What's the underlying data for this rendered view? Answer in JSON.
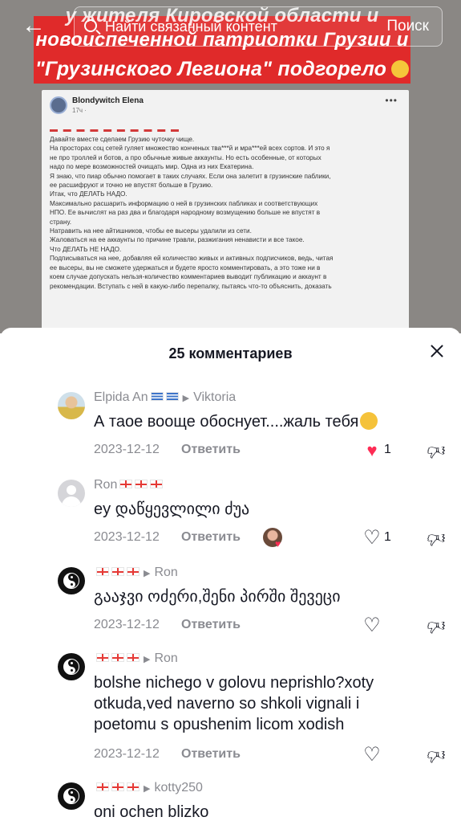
{
  "topbar": {
    "back_icon": "arrow-left-icon",
    "search_placeholder": "Найти связанный контент",
    "search_button": "Поиск"
  },
  "video": {
    "banner_line1": "у жителя Кировской области и",
    "banner_line2": "новоиспеченной патриотки Грузии и",
    "banner_line3": "\"Грузинского Легиона\" подгорело",
    "post": {
      "author": "Blondywitch Elena",
      "meta": "17ч · ",
      "lines": [
        "Давайте вместе сделаем Грузию чуточку чище.",
        "На просторах соц сетей гуляет множество конченых тва***й и мра***ей всех сортов. И это я",
        "не про троллей и ботов, а про обычные живые аккаунты. Но есть особенные, от которых",
        "надо по мере возможностей очищать мир. Одна из них Екатерина.",
        "Я знаю, что пиар обычно помогает в таких случаях. Если она залетит в грузинские паблики,",
        "ее расшифруют и точно не впустят больше в Грузию.",
        "Итак, что ДЕЛАТЬ НАДО.",
        "Максимально расшарить информацию о ней в грузинских пабликах и соответствующих",
        "НПО. Ее вычислят на раз два и благодаря народному возмущению больше не впустят в",
        "страну.",
        "Натравить на нее айтишников, чтобы ее высеры удалили из сети.",
        "Жаловаться на ее аккаунты по причине травли, разжигания ненависти и все такое.",
        "Что ДЕЛАТЬ НЕ НАДО.",
        "Подписываться на нее, добавляя ей количество живых и активных подписчиков, ведь, читая",
        "ее высеры, вы не сможете удержаться и будете яросто комментировать, а это тоже ни в",
        "коем случае допускать нельзя-количество комментариев выводит публикацию и аккаунт в",
        "рекомендации. Вступать с ней в какую-либо перепалку, пытаясь что-то объяснить, доказать"
      ]
    }
  },
  "comments_panel": {
    "title": "25 комментариев",
    "reply_label": "Ответить",
    "comments": [
      {
        "user": "Elpida An",
        "reply_to": "Viktoria",
        "text": "А таое вооще обоснует....жаль тебя",
        "date": "2023-12-12",
        "likes": "1",
        "liked": true
      },
      {
        "user": "Ron",
        "reply_to": "",
        "text": "ey დაწყევლილი ძუა",
        "date": "2023-12-12",
        "likes": "1",
        "liked": false
      },
      {
        "user": "",
        "reply_to": "Ron",
        "text": "გააჯვი ოძერი,შენი პირში შევეცი",
        "date": "2023-12-12",
        "likes": "",
        "liked": false
      },
      {
        "user": "",
        "reply_to": "Ron",
        "text_lines": [
          "bolshe nichego v golovu neprishlo?xoty",
          "otkuda,ved naverno so shkoli vignali i",
          "poetomu s opushenim licom xodish"
        ],
        "date": "2023-12-12",
        "likes": "",
        "liked": false
      },
      {
        "user": "",
        "reply_to": "kotty250",
        "text": "oni ochen blizko",
        "date": "",
        "likes": "",
        "liked": false
      }
    ]
  },
  "colors": {
    "banner_red": "#e02a2a",
    "like_red": "#fe2c55",
    "secondary_text": "#8a8b91",
    "primary_text": "#161823"
  }
}
